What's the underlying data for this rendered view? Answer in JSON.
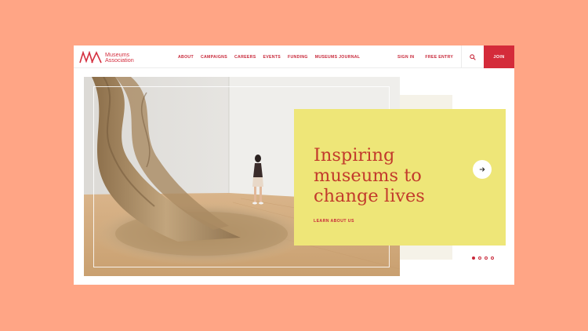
{
  "logo": {
    "mark": "MA",
    "line1": "Museums",
    "line2": "Association"
  },
  "nav": {
    "items": [
      "ABOUT",
      "CAMPAIGNS",
      "CAREERS",
      "EVENTS",
      "FUNDING",
      "MUSEUMS JOURNAL"
    ],
    "sign_in": "SIGN IN",
    "free_entry": "FREE ENTRY",
    "join": "JOIN",
    "search_icon": "search-icon"
  },
  "hero": {
    "headline": [
      "Inspiring",
      "museums to",
      "change lives"
    ],
    "cta": "LEARN ABOUT US",
    "next_icon": "arrow-right-icon",
    "slides": 4,
    "active_slide": 1
  },
  "colors": {
    "background": "#ffa585",
    "accent": "#d42b3a",
    "card": "#eee678",
    "headline": "#c23a2c"
  }
}
